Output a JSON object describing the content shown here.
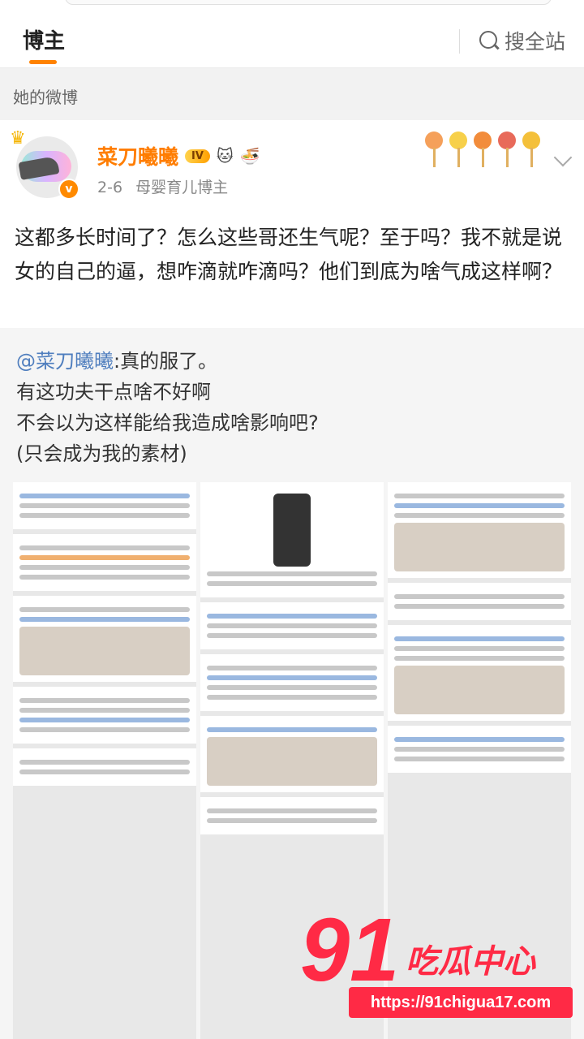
{
  "tabs": {
    "blogger": "博主",
    "search_all": "搜全站"
  },
  "section_label": "她的微博",
  "post": {
    "author": "菜刀曦曦",
    "level_badge": "IV",
    "date": "2-6",
    "category": "母婴育儿博主",
    "text": "这都多长时间了？怎么这些哥还生气呢？至于吗？我不就是说女的自己的逼，想咋滴就咋滴吗？他们到底为啥气成这样啊？",
    "deco_colors": [
      "#f5a05a",
      "#f7d04a",
      "#f28c3b",
      "#e86a5a",
      "#f4c03a"
    ]
  },
  "repost": {
    "mention": "@菜刀曦曦",
    "line1_rest": ":真的服了。",
    "line2": "有这功夫干点啥不好啊",
    "line3": "不会以为这样能给我造成啥影响吧?",
    "line4": "(只会成为我的素材)"
  },
  "watermark": {
    "logo_number": "91",
    "logo_text": "吃瓜中心",
    "url": "https://91chigua17.com"
  },
  "colors": {
    "accent": "#ff8200",
    "author": "#ff7d00",
    "mention": "#4f7ebe",
    "watermark": "#ff2a45"
  }
}
